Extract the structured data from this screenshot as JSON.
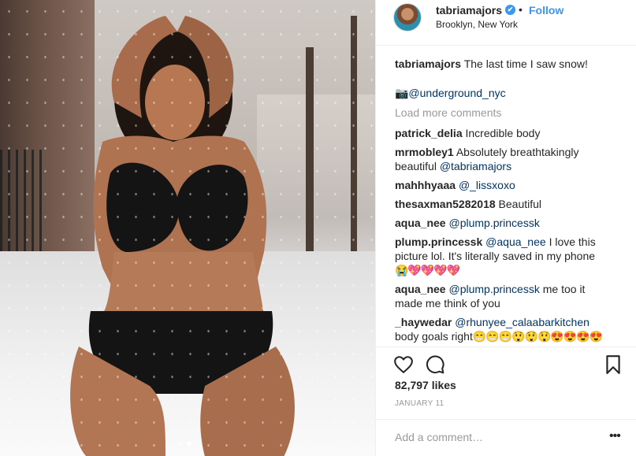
{
  "post": {
    "image_dots": [
      false,
      true
    ],
    "header": {
      "username": "tabriamajors",
      "verified_mark": "✔",
      "separator": "•",
      "follow_label": "Follow",
      "location": "Brooklyn, New York"
    },
    "caption": {
      "user": "tabriamajors",
      "text": "The last time I saw snow!",
      "credit": "📷@underground_nyc"
    },
    "load_more": "Load more comments",
    "comments": [
      {
        "user": "patrick_delia",
        "text": "Incredible body"
      },
      {
        "user": "mrmobley1",
        "text": "Absolutely breathtakingly",
        "text2_pre": "beautiful ",
        "mention": "@tabriamajors"
      },
      {
        "user": "mahhhyaaa",
        "mention": "@_lissxoxo"
      },
      {
        "user": "thesaxman5282018",
        "text": "Beautiful"
      },
      {
        "user": "aqua_nee",
        "mention": "@plump.princessk"
      },
      {
        "user": "plump.princessk",
        "mention": "@aqua_nee",
        "text": "I love this",
        "text2": "picture lol. It's literally saved in my phone",
        "emoji": "😭💖💖💖💖"
      },
      {
        "user": "aqua_nee",
        "mention": "@plump.princessk",
        "text": "me too it",
        "text2": "made me think of you"
      },
      {
        "user": "_haywedar",
        "mention": "@rhunyee_calaabarkitchen",
        "text2": "body goals right",
        "emoji": "😁😁😁😲😲😲😍😍😍😍"
      }
    ],
    "likes": "82,797 likes",
    "date": "JANUARY 11",
    "add_comment_placeholder": "Add a comment…",
    "more_label": "•••"
  },
  "icons": {
    "heart": "heart-icon",
    "comment": "comment-icon",
    "bookmark": "bookmark-icon",
    "more": "more-options-icon",
    "verified": "verified-badge-icon"
  },
  "colors": {
    "accent": "#3897f0",
    "text": "#262626",
    "muted": "#999999",
    "mention": "#003569",
    "border": "#efefef"
  }
}
